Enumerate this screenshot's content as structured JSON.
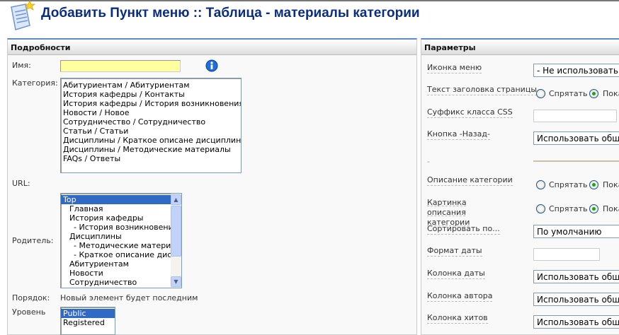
{
  "header": {
    "title": "Добавить Пункт меню :: Таблица - материалы категории",
    "icon": "menu-add-icon"
  },
  "details": {
    "heading": "Подробности",
    "name_label": "Имя:",
    "name_value": "",
    "category_label": "Категория:",
    "categories": [
      "Абитуриентам / Абитуриентам",
      "История кафедры / Контакты",
      "История кафедры / История возникновения",
      "Новости / Новое",
      "Сотрудничество / Сотрудничество",
      "Статьи / Статьи",
      "Дисциплины / Краткое описане дисциплины",
      "Дисциплины / Методические материалы",
      "FAQs / Ответы"
    ],
    "url_label": "URL:",
    "parent_label": "Родитель:",
    "parents": [
      "Top",
      "Главная",
      "История кафедры",
      "- История возникновения",
      "Дисциплины",
      "- Методические материалы",
      "- Краткое описание дисциплины",
      "Абитуриентам",
      "Новости",
      "Сотрудничество"
    ],
    "parent_selected": "Top",
    "order_label": "Порядок:",
    "order_value": "Новый элемент будет последним",
    "level_label": "Уровень",
    "levels": [
      "Public",
      "Registered"
    ],
    "level_selected": "Public"
  },
  "params": {
    "heading": "Параметры",
    "menu_icon_label": "Иконка меню",
    "menu_icon_value": "- Не использовать картинку -",
    "page_title_label": "Текст заголовка страницы",
    "hide": "Спрятать",
    "show": "Показать",
    "css_suffix_label": "Суффикс класса CSS",
    "css_suffix_value": "",
    "back_button_label": "Кнопка -Назад-",
    "back_button_value": "Использовать общие настройки",
    "separator_label": "-",
    "cat_desc_label": "Описание категории",
    "cat_image_label": "Картинка описания категории",
    "sort_label": "Сортировать по...",
    "sort_value": "По умолчанию",
    "date_format_label": "Формат даты",
    "date_format_value": "",
    "date_col_label": "Колонка даты",
    "date_col_value": "Использовать общие настройки",
    "author_col_label": "Колонка автора",
    "author_col_value": "Использовать общие настройки",
    "hits_col_label": "Колонка хитов",
    "hits_col_value": "Использовать общие настройки"
  }
}
